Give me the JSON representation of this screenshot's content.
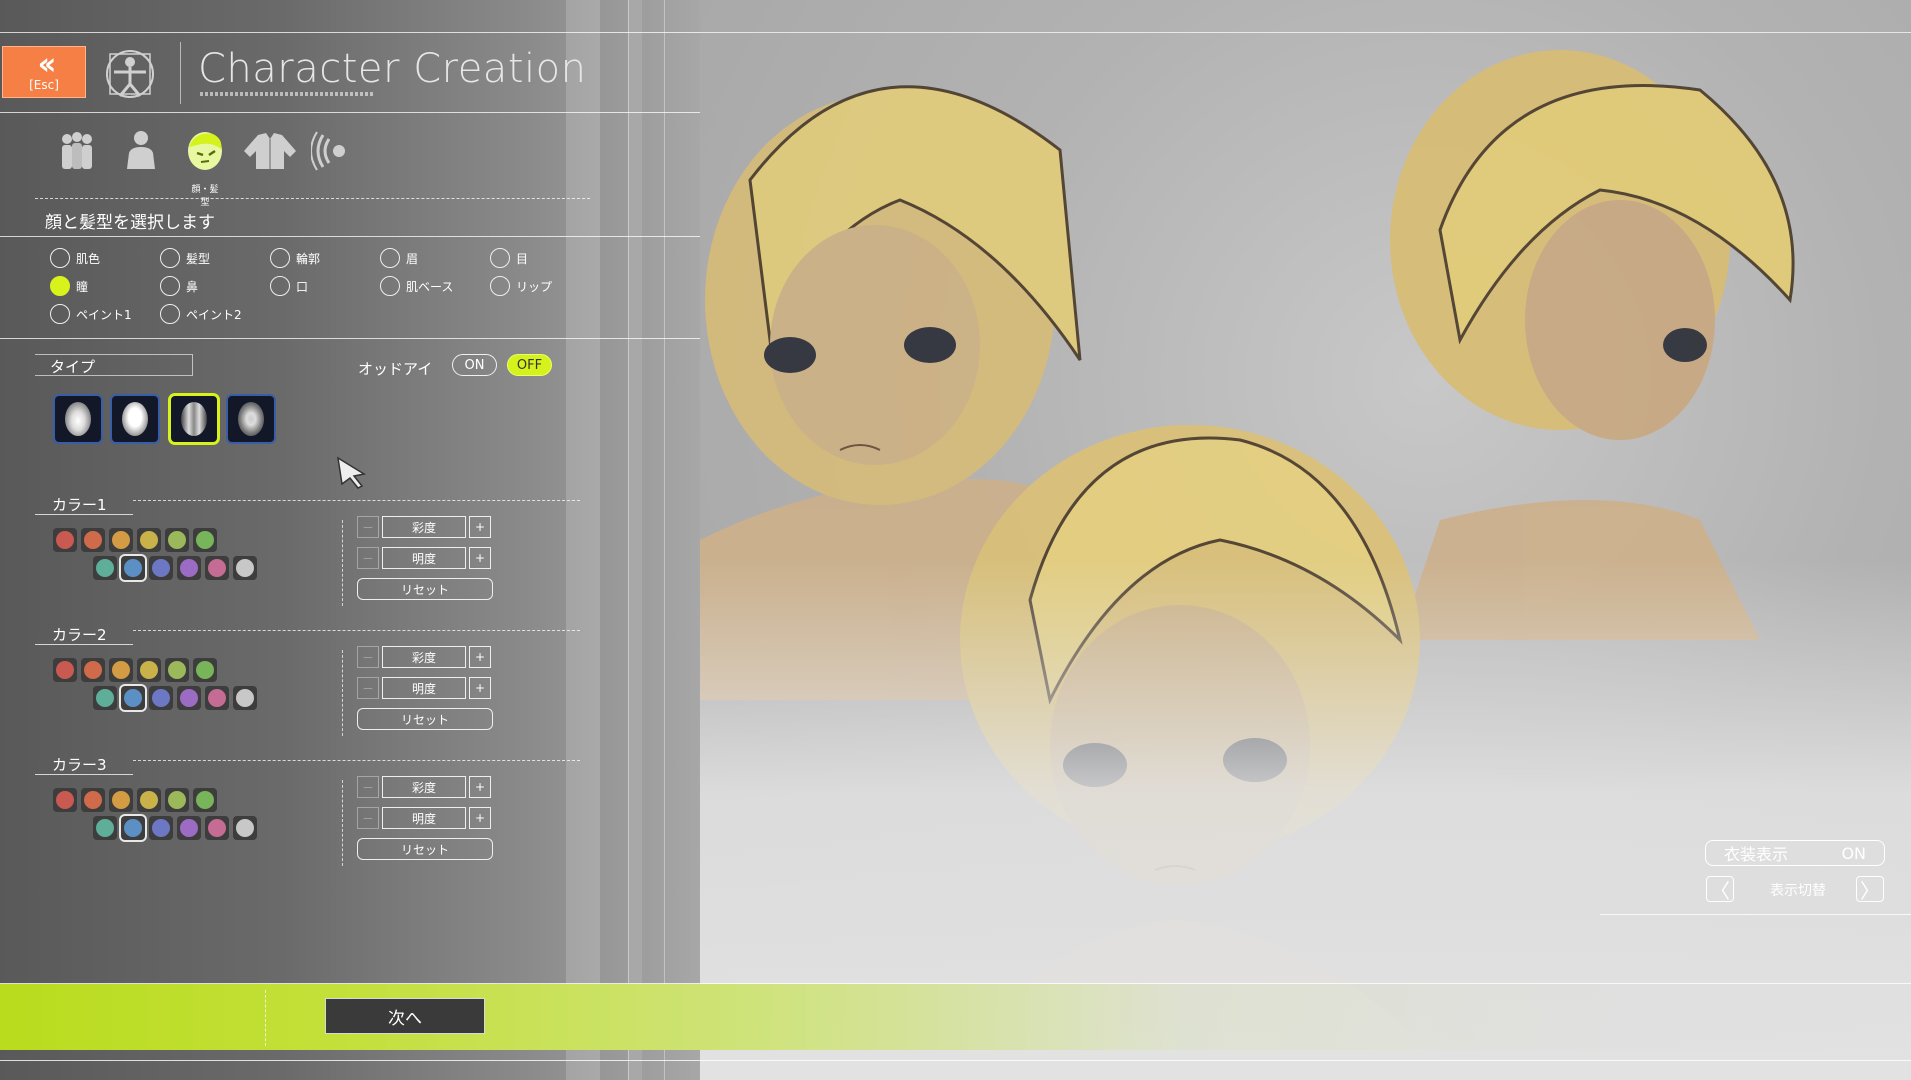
{
  "header": {
    "esc_label": "[Esc]",
    "title": "Character Creation"
  },
  "category_tabs": {
    "items": [
      {
        "name": "preset-icon"
      },
      {
        "name": "body-icon"
      },
      {
        "name": "face-hair-icon"
      },
      {
        "name": "clothes-icon"
      },
      {
        "name": "voice-icon"
      }
    ],
    "selected_label": "顔・髪型"
  },
  "section": {
    "title": "顔と髪型を選択します"
  },
  "parts": {
    "options": [
      "肌色",
      "髪型",
      "輪郭",
      "眉",
      "目",
      "瞳",
      "鼻",
      "口",
      "肌ベース",
      "リップ",
      "ペイント1",
      "ペイント2"
    ],
    "selected": "瞳"
  },
  "type_section": {
    "label": "タイプ",
    "odd_eye_label": "オッドアイ",
    "on_label": "ON",
    "off_label": "OFF",
    "odd_eye_state": "OFF",
    "selected_type_index": 2
  },
  "colors": {
    "palette": [
      "#c85a52",
      "#cf6b4a",
      "#d39b44",
      "#c9b24a",
      "#9bb85a",
      "#78b45a",
      "#5fae9a",
      "#5c90c4",
      "#6c78c4",
      "#9c6cc4",
      "#c46c94",
      "#c8c8c8"
    ],
    "selected_swatch_index": 7,
    "sections": [
      {
        "label": "カラー1"
      },
      {
        "label": "カラー2"
      },
      {
        "label": "カラー3"
      }
    ],
    "minus": "－",
    "plus": "+",
    "saturation_label": "彩度",
    "brightness_label": "明度",
    "reset_label": "リセット"
  },
  "footer": {
    "next_label": "次へ"
  },
  "viewer": {
    "costume_label": "衣装表示",
    "costume_state": "ON",
    "view_switch_label": "表示切替",
    "prev_glyph": "〈",
    "next_glyph": "〉"
  },
  "accent_color": "#d6f21c",
  "esc_color": "#f57f45"
}
